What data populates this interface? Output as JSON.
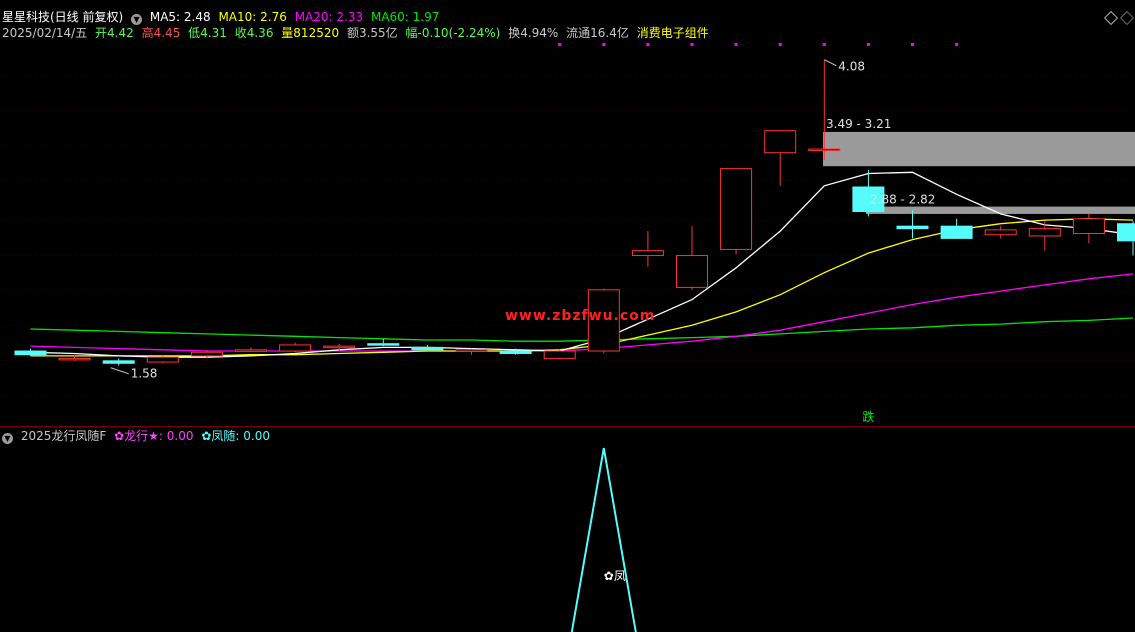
{
  "header": {
    "stock_name": "星星科技(日线 前复权)",
    "ma5_label": "MA5: 2.48",
    "ma10_label": "MA10: 2.76",
    "ma20_label": "MA20: 2.33",
    "ma60_label": "MA60: 1.97",
    "date_label": "2025/02/14/五",
    "open_label": "开4.42",
    "high_label": "高4.45",
    "low_label": "低4.31",
    "close_label": "收4.36",
    "volume_label": "量812520",
    "amount_label": "额3.55亿",
    "change_label": "幅-0.10(-2.24%)",
    "turnover_label": "换4.94%",
    "float_label": "流通16.4亿",
    "sector_label": "消费电子组件"
  },
  "indicator": {
    "title": "2025龙行凤随F",
    "long_label": "✿龙行★: 0.00",
    "feng_label": "✿凤随: 0.00",
    "marker_label": "✿凤"
  },
  "watermark": "www.zbzfwu.com",
  "colors": {
    "background": "#000000",
    "up": "#ff3232",
    "down": "#54fcfc",
    "ma5": "#ffffff",
    "ma10": "#ffff00",
    "ma20": "#ff00ff",
    "ma60": "#00e600",
    "zone": "#9a9a9a",
    "indicator_line": "#54fcfc",
    "watermark": "#ff2020"
  },
  "chart_data": {
    "type": "candlestick",
    "ylim": [
      1.3,
      4.2
    ],
    "candles": [
      {
        "o": 1.7,
        "h": 1.72,
        "l": 1.66,
        "c": 1.67
      },
      {
        "o": 1.64,
        "h": 1.67,
        "l": 1.62,
        "c": 1.64
      },
      {
        "o": 1.62,
        "h": 1.64,
        "l": 1.58,
        "c": 1.6
      },
      {
        "o": 1.61,
        "h": 1.66,
        "l": 1.6,
        "c": 1.65
      },
      {
        "o": 1.66,
        "h": 1.71,
        "l": 1.64,
        "c": 1.69
      },
      {
        "o": 1.71,
        "h": 1.73,
        "l": 1.69,
        "c": 1.71
      },
      {
        "o": 1.7,
        "h": 1.77,
        "l": 1.69,
        "c": 1.75
      },
      {
        "o": 1.73,
        "h": 1.76,
        "l": 1.7,
        "c": 1.74
      },
      {
        "o": 1.76,
        "h": 1.8,
        "l": 1.74,
        "c": 1.75
      },
      {
        "o": 1.73,
        "h": 1.75,
        "l": 1.7,
        "c": 1.71
      },
      {
        "o": 1.7,
        "h": 1.72,
        "l": 1.67,
        "c": 1.71
      },
      {
        "o": 1.7,
        "h": 1.72,
        "l": 1.67,
        "c": 1.68
      },
      {
        "o": 1.64,
        "h": 1.71,
        "l": 1.63,
        "c": 1.7
      },
      {
        "o": 1.7,
        "h": 2.21,
        "l": 1.68,
        "c": 2.2
      },
      {
        "o": 2.48,
        "h": 2.68,
        "l": 2.39,
        "c": 2.52
      },
      {
        "o": 2.22,
        "h": 2.72,
        "l": 2.2,
        "c": 2.48
      },
      {
        "o": 2.53,
        "h": 3.18,
        "l": 2.49,
        "c": 3.19
      },
      {
        "o": 3.32,
        "h": 3.5,
        "l": 3.05,
        "c": 3.5
      },
      {
        "o": 3.35,
        "h": 4.08,
        "l": 3.26,
        "c": 3.35
      },
      {
        "o": 3.04,
        "h": 3.18,
        "l": 2.8,
        "c": 2.84
      },
      {
        "o": 2.72,
        "h": 2.85,
        "l": 2.62,
        "c": 2.7
      },
      {
        "o": 2.72,
        "h": 2.78,
        "l": 2.62,
        "c": 2.62
      },
      {
        "o": 2.65,
        "h": 2.72,
        "l": 2.62,
        "c": 2.69
      },
      {
        "o": 2.64,
        "h": 2.76,
        "l": 2.52,
        "c": 2.7
      },
      {
        "o": 2.66,
        "h": 2.82,
        "l": 2.58,
        "c": 2.78
      },
      {
        "o": 2.74,
        "h": 2.76,
        "l": 2.48,
        "c": 2.6
      }
    ],
    "ma5": [
      1.69,
      1.68,
      1.66,
      1.65,
      1.65,
      1.66,
      1.68,
      1.71,
      1.73,
      1.73,
      1.72,
      1.71,
      1.7,
      1.8,
      1.96,
      2.12,
      2.38,
      2.68,
      3.05,
      3.15,
      3.16,
      2.98,
      2.82,
      2.73,
      2.7,
      2.65
    ],
    "ma10": [
      1.66,
      1.66,
      1.66,
      1.66,
      1.66,
      1.67,
      1.67,
      1.68,
      1.69,
      1.7,
      1.7,
      1.7,
      1.71,
      1.75,
      1.83,
      1.91,
      2.02,
      2.16,
      2.34,
      2.5,
      2.61,
      2.69,
      2.74,
      2.77,
      2.78,
      2.77
    ],
    "ma20": [
      1.74,
      1.73,
      1.72,
      1.71,
      1.7,
      1.7,
      1.7,
      1.7,
      1.7,
      1.7,
      1.7,
      1.7,
      1.7,
      1.72,
      1.75,
      1.78,
      1.82,
      1.87,
      1.94,
      2.01,
      2.08,
      2.14,
      2.19,
      2.24,
      2.29,
      2.33
    ],
    "ma60": [
      1.88,
      1.87,
      1.86,
      1.85,
      1.84,
      1.83,
      1.82,
      1.81,
      1.8,
      1.79,
      1.79,
      1.78,
      1.78,
      1.79,
      1.8,
      1.81,
      1.82,
      1.84,
      1.86,
      1.88,
      1.89,
      1.91,
      1.92,
      1.94,
      1.95,
      1.97
    ],
    "annotations": {
      "high_label": "4.08",
      "high_value": 4.08,
      "low_label": "1.58",
      "low_value": 1.58,
      "zone1_label": "3.49 - 3.21",
      "zone1": [
        3.21,
        3.49
      ],
      "zone2_label": "2.88 - 2.82",
      "zone2": [
        2.82,
        2.88
      ],
      "sell_label": "跌"
    },
    "indicator_values": [
      0,
      0,
      0,
      0,
      0,
      0,
      0,
      0,
      0,
      0,
      0,
      0,
      0,
      1,
      0,
      0,
      0,
      0,
      0,
      0,
      0,
      0,
      0,
      0,
      0,
      0
    ]
  }
}
